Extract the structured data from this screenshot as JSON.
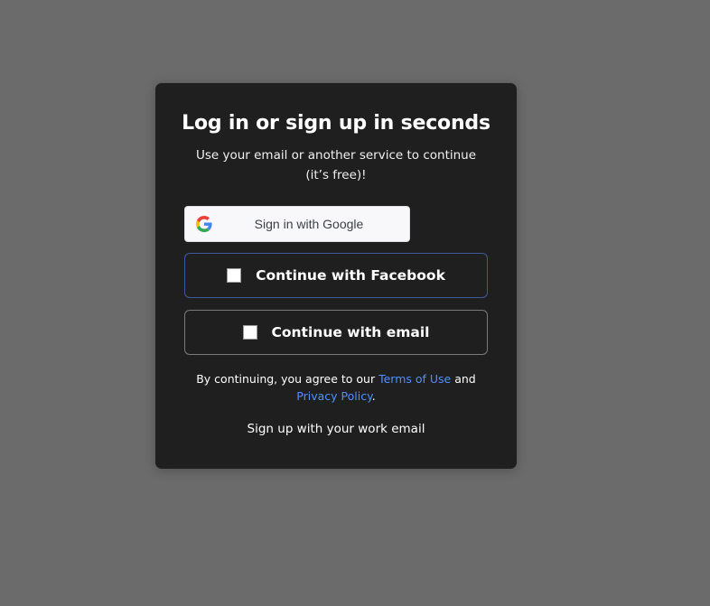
{
  "modal": {
    "title": "Log in or sign up in seconds",
    "subtitle": "Use your email or another service to continue (it’s free)!",
    "google_button": {
      "label": "Sign in with Google",
      "icon": "google-logo-icon"
    },
    "facebook_button": {
      "label": "Continue with Facebook",
      "icon": "broken-image-icon"
    },
    "email_button": {
      "label": "Continue with email",
      "icon": "broken-image-icon"
    },
    "legal": {
      "prefix": "By continuing, you agree to our ",
      "terms_link": "Terms of Use",
      "and": " and ",
      "privacy_link": "Privacy Policy",
      "suffix": "."
    },
    "work_email_link": "Sign up with your work email"
  },
  "colors": {
    "backdrop": "#6b6b6b",
    "modal_background": "#1f1f1f",
    "link": "#4d90fe",
    "facebook_border": "#3f5a9a",
    "email_border": "#7a7a7a"
  }
}
